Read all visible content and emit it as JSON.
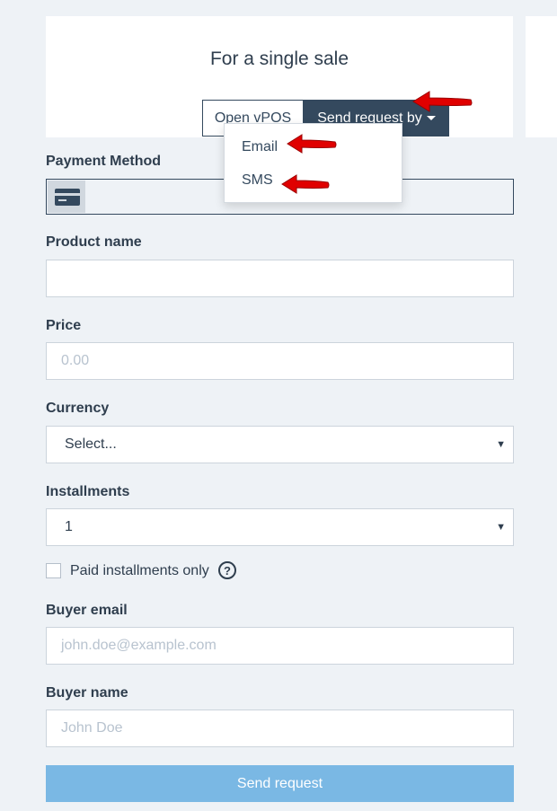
{
  "card": {
    "title": "For a single sale",
    "open_vpos_label": "Open vPOS",
    "send_request_label": "Send request by"
  },
  "dropdown": {
    "items": [
      {
        "label": "Email"
      },
      {
        "label": "SMS"
      }
    ]
  },
  "form": {
    "payment_method_label": "Payment Method",
    "product_name_label": "Product name",
    "product_name_value": "",
    "price_label": "Price",
    "price_placeholder": "0.00",
    "currency_label": "Currency",
    "currency_value": "Select...",
    "installments_label": "Installments",
    "installments_value": "1",
    "paid_installments_label": "Paid installments only",
    "help_symbol": "?",
    "buyer_email_label": "Buyer email",
    "buyer_email_placeholder": "john.doe@example.com",
    "buyer_name_label": "Buyer name",
    "buyer_name_placeholder": "John Doe",
    "submit_label": "Send request"
  },
  "icons": {
    "payment": "credit-card-icon",
    "select_arrow": "triangle-down-icon",
    "annotation": "red-arrow-icon"
  },
  "colors": {
    "primary_dark": "#34495e",
    "submit_button": "#7ab8e4",
    "annotation_arrow": "#e00000",
    "background": "#eef2f6"
  }
}
